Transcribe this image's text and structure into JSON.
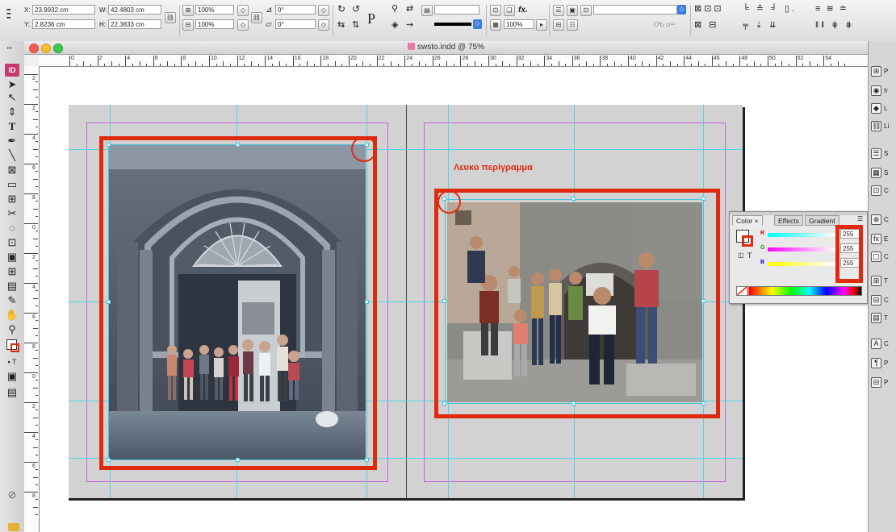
{
  "control_bar": {
    "x_label": "X:",
    "x_value": "23.9932 cm",
    "y_label": "Y:",
    "y_value": "2.8236 cm",
    "w_label": "W:",
    "w_value": "42.4803 cm",
    "h_label": "H:",
    "h_value": "22.3833 cm",
    "scale_x": "100%",
    "scale_y": "100%",
    "rotate": "0°",
    "shear": "0°",
    "stroke_pct": "100%"
  },
  "window": {
    "doc_title": "swsto.indd @ 75%",
    "app_badge": "ID"
  },
  "ruler": {
    "h_numbers": [
      "0",
      "2",
      "4",
      "6",
      "8",
      "10",
      "12",
      "14",
      "16",
      "18",
      "20",
      "22",
      "24",
      "26",
      "28",
      "30",
      "32",
      "34",
      "36",
      "38",
      "40",
      "42",
      "44",
      "46",
      "48",
      "50",
      "52",
      "54"
    ],
    "v_numbers": [
      "2",
      "2",
      "4",
      "6",
      "8",
      "0",
      "2",
      "4",
      "6",
      "8",
      "0",
      "2",
      "4",
      "6",
      "8"
    ]
  },
  "annotation": {
    "heading": "Λευκο περίγραμμα"
  },
  "color_panel": {
    "tab_color": "Color",
    "tab_effects": "Effects",
    "tab_gradient": "Gradient",
    "r_label": "R",
    "g_label": "G",
    "b_label": "B",
    "r_value": "255",
    "g_value": "255",
    "b_value": "255",
    "text_toggle": "T"
  },
  "dock": {
    "items": [
      "P",
      "Ir",
      "L",
      "Li",
      "S",
      "S",
      "C",
      "C",
      "E",
      "C",
      "T",
      "C",
      "T",
      "C",
      "P",
      "P"
    ]
  },
  "colors": {
    "accent_red": "#e02a10",
    "guide_cyan": "#4fd6e6",
    "margin_purple": "#c066e0"
  }
}
